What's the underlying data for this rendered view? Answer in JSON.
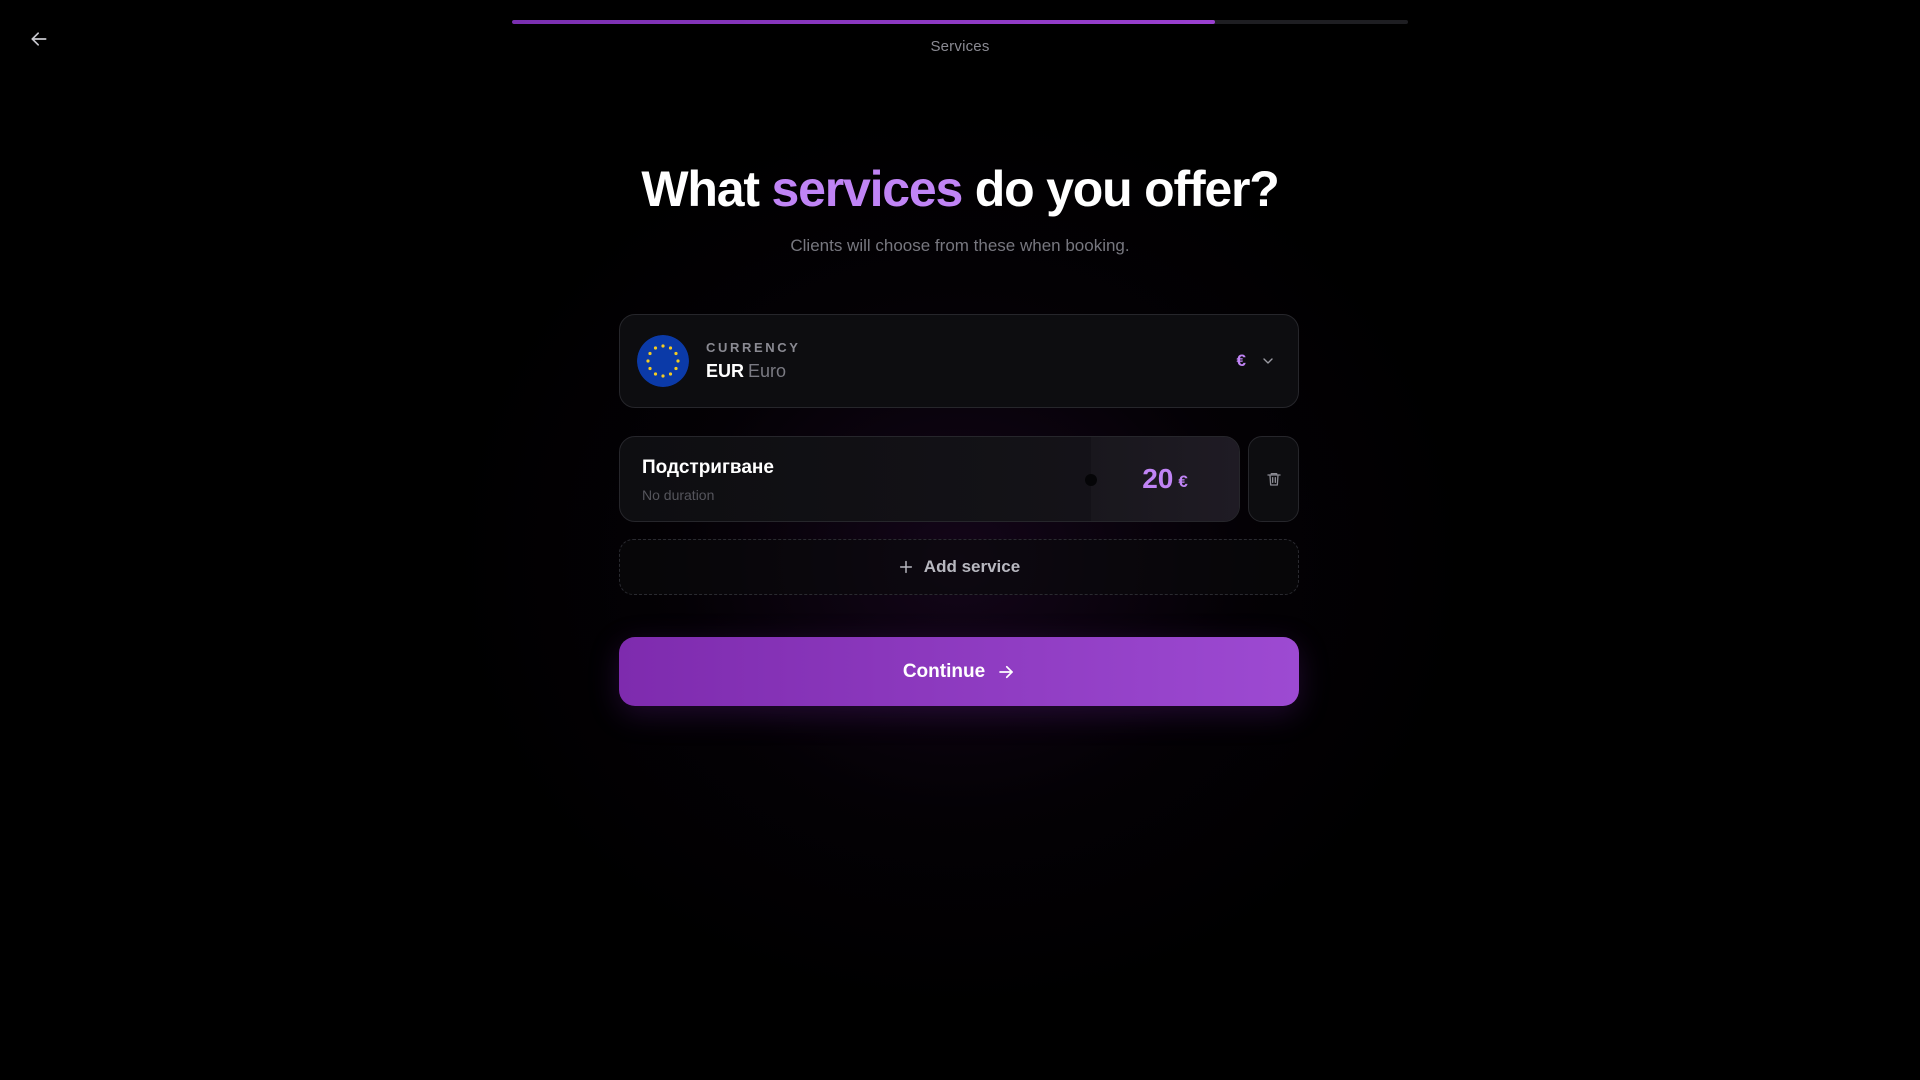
{
  "header": {
    "step_label": "Services",
    "progress_fraction": 0.785
  },
  "hero": {
    "title_prefix": "What",
    "title_accent": "services",
    "title_suffix": "do you offer?",
    "subtitle": "Clients will choose from these when booking."
  },
  "currency": {
    "label": "CURRENCY",
    "code": "EUR",
    "name": "Euro",
    "symbol": "€",
    "flag_icon": "eu-flag-icon"
  },
  "services": [
    {
      "name": "Подстригване",
      "duration": "No duration",
      "price": "20",
      "currency_symbol": "€"
    }
  ],
  "actions": {
    "add_service": "Add service",
    "continue": "Continue"
  },
  "colors": {
    "accent": "#c084f5",
    "button_start": "#7e2bae",
    "button_end": "#9d4ad2",
    "background": "#000000"
  }
}
